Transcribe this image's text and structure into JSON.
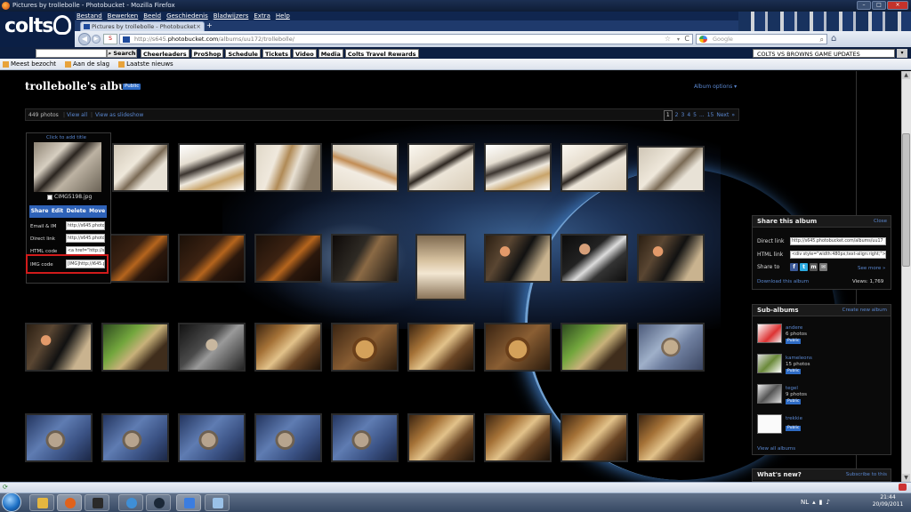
{
  "window": {
    "title": "Pictures by trollebolle - Photobucket - Mozilla Firefox",
    "minimize": "–",
    "maximize": "□",
    "close": "×"
  },
  "header": {
    "logo_text": "colts",
    "promo_text": ""
  },
  "menu": [
    "Bestand",
    "Bewerken",
    "Beeld",
    "Geschiedenis",
    "Bladwijzers",
    "Extra",
    "Help"
  ],
  "tab": {
    "label": "Pictures by trollebolle - Photobucket",
    "close": "×",
    "new_tab": "+"
  },
  "nav": {
    "back": "◀",
    "forward": "▶",
    "url_prefix": "http://s645.",
    "url_domain": "photobucket.com",
    "url_suffix": "/albums/uu172/trollebolle/",
    "star": "☆",
    "drop": "▾",
    "reload": "C",
    "search_placeholder": "Google",
    "search_glyph": "⌕",
    "home": "⌂"
  },
  "toolbar": {
    "search_label": "Search",
    "search_icon": "magnifier-icon",
    "links": [
      "Cheerleaders",
      "ProShop",
      "Schedule",
      "Tickets",
      "Video",
      "Media",
      "Colts Travel Rewards"
    ],
    "ticker": "COLTS VS BROWNS GAME UPDATES",
    "ticker_arrow": "▾"
  },
  "bookmarks": [
    "Meest bezocht",
    "Aan de slag",
    "Laatste nieuws"
  ],
  "album": {
    "title": "trollebolle's album",
    "badge": "Public",
    "options": "Album options ▾",
    "count": "449 photos",
    "sep": "|",
    "view_all": "View all",
    "slideshow": "View as slideshow",
    "pager": [
      "1",
      "2",
      "3",
      "4",
      "5",
      "...",
      "15",
      "Next",
      "»"
    ]
  },
  "popup": {
    "click_to_add_title": "Click to add title",
    "filename": "CIMG5198.jpg",
    "actions": [
      "Share",
      "Edit",
      "Delete",
      "Move"
    ],
    "fields": [
      {
        "label": "Email & IM",
        "value": "http://s645.photob"
      },
      {
        "label": "Direct link",
        "value": "http://s645.photob"
      },
      {
        "label": "HTML code",
        "value": "<a href=\"http://s"
      },
      {
        "label": "IMG code",
        "value": "[IMG]http://i645.p"
      }
    ]
  },
  "share": {
    "title": "Share this album",
    "close": "Close",
    "direct_label": "Direct link",
    "direct_value": "http://s645.photobucket.com/albums/uu17",
    "html_label": "HTML link",
    "html_value": "<div style=\"width:480px;text-align:right;\"><",
    "share_to": "Share to",
    "icons": [
      {
        "name": "facebook-icon",
        "glyph": "f",
        "color": "#3b5998"
      },
      {
        "name": "twitter-icon",
        "glyph": "t",
        "color": "#2aa9e0"
      },
      {
        "name": "myspace-icon",
        "glyph": "m",
        "color": "#555"
      },
      {
        "name": "email-icon",
        "glyph": "✉",
        "color": "#777"
      }
    ],
    "see_more": "See more »",
    "download": "Download this album",
    "views": "Views: 1,769"
  },
  "subalbums": {
    "title": "Sub-albums",
    "create": "Create new album",
    "items": [
      {
        "name": "andere",
        "count": "6 photos",
        "badge": "Public"
      },
      {
        "name": "kameleons",
        "count": "15 photos",
        "badge": "Public"
      },
      {
        "name": "tegel",
        "count": "9 photos",
        "badge": "Public"
      },
      {
        "name": "trekkie",
        "count": "",
        "badge": "Public"
      }
    ],
    "view_all": "View all albums"
  },
  "whatsnew": {
    "title": "What's new?",
    "link": "Subscribe to this"
  },
  "statusbar": {
    "done": "⟳"
  },
  "taskbar": {
    "items": [
      {
        "name": "explorer-taskbar-icon",
        "color": "#e4b640"
      },
      {
        "name": "firefox-taskbar-icon",
        "color": "#e0621b"
      },
      {
        "name": "media-taskbar-icon",
        "color": "#2a2a2a"
      },
      {
        "name": "itunes-taskbar-icon",
        "color": "#3f8fd6"
      },
      {
        "name": "steam-taskbar-icon",
        "color": "#1b2838"
      },
      {
        "name": "photobucket-taskbar-icon",
        "color": "#3b7de0"
      },
      {
        "name": "paint-taskbar-icon",
        "color": "#9ac1e8"
      }
    ],
    "language": "NL",
    "time": "21:44",
    "date": "20/09/2011"
  }
}
